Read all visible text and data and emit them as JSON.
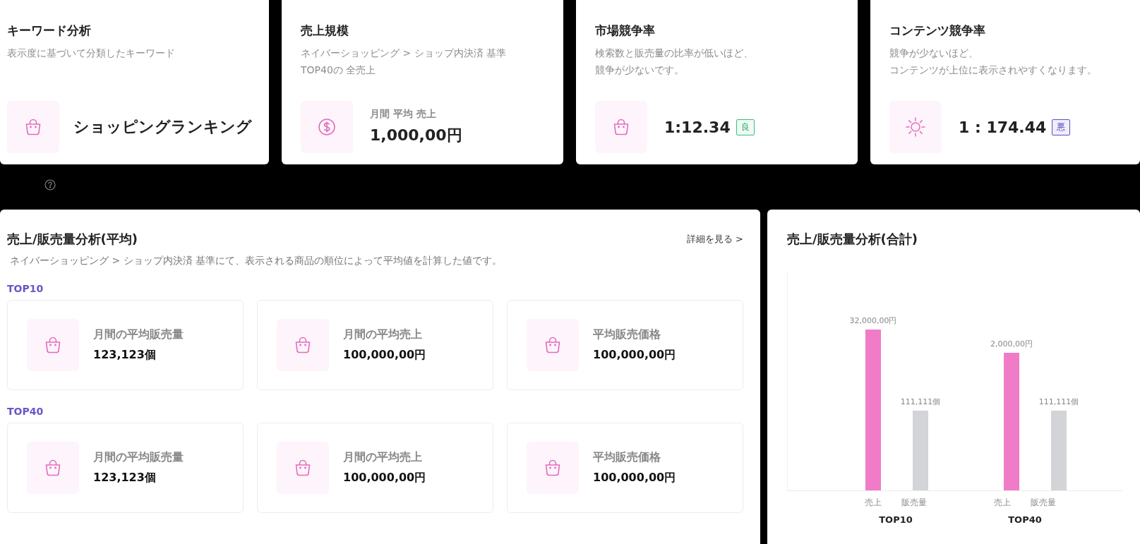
{
  "summary_cards": [
    {
      "title": "キーワード分析",
      "description": [
        "表示度に基づいて分類したキーワード"
      ],
      "value": "ショッピングランキング"
    },
    {
      "title": "売上規模",
      "description": [
        "ネイバーショッピング > ショップ内決済 基準",
        "TOP40の 全売上"
      ],
      "caption": "月間 平均 売上",
      "value": "1,000,00円"
    },
    {
      "title": "市場競争率",
      "description": [
        "検索数と販売量の比率が低いほど、",
        "競争が少ないです。"
      ],
      "value": "1:12.34",
      "badge": {
        "label": "良",
        "kind": "good"
      }
    },
    {
      "title": "コンテンツ競争率",
      "description": [
        "競争が少ないほど、",
        "コンテンツが上位に表示されやすくなります。"
      ],
      "value": "1 : 174.44",
      "badge": {
        "label": "悪",
        "kind": "bad"
      }
    }
  ],
  "average_panel": {
    "title": "売上/販売量分析(平均)",
    "link": "詳細を見る >",
    "description": "ネイバーショッピング > ショップ内決済 基準にて、表示される商品の順位によって平均値を計算した値です。",
    "groups": [
      {
        "label": "TOP10",
        "stats": [
          {
            "label": "月間の平均販売量",
            "value": "123,123個"
          },
          {
            "label": "月間の平均売上",
            "value": "100,000,00円"
          },
          {
            "label": "平均販売価格",
            "value": "100,000,00円"
          }
        ]
      },
      {
        "label": "TOP40",
        "stats": [
          {
            "label": "月間の平均販売量",
            "value": "123,123個"
          },
          {
            "label": "月間の平均売上",
            "value": "100,000,00円"
          },
          {
            "label": "平均販売価格",
            "value": "100,000,00円"
          }
        ]
      }
    ]
  },
  "total_panel": {
    "title": "売上/販売量分析(合計)",
    "groups": [
      {
        "label": "TOP10",
        "bars": [
          {
            "label": "売上",
            "value": "32,000,00円",
            "color": "#f07cc8"
          },
          {
            "label": "販売量",
            "value": "111,111個",
            "color": "#d3d4d8"
          }
        ]
      },
      {
        "label": "TOP40",
        "bars": [
          {
            "label": "売上",
            "value": "2,000,00円",
            "color": "#f07cc8"
          },
          {
            "label": "販売量",
            "value": "111,111個",
            "color": "#d3d4d8"
          }
        ]
      }
    ]
  }
}
